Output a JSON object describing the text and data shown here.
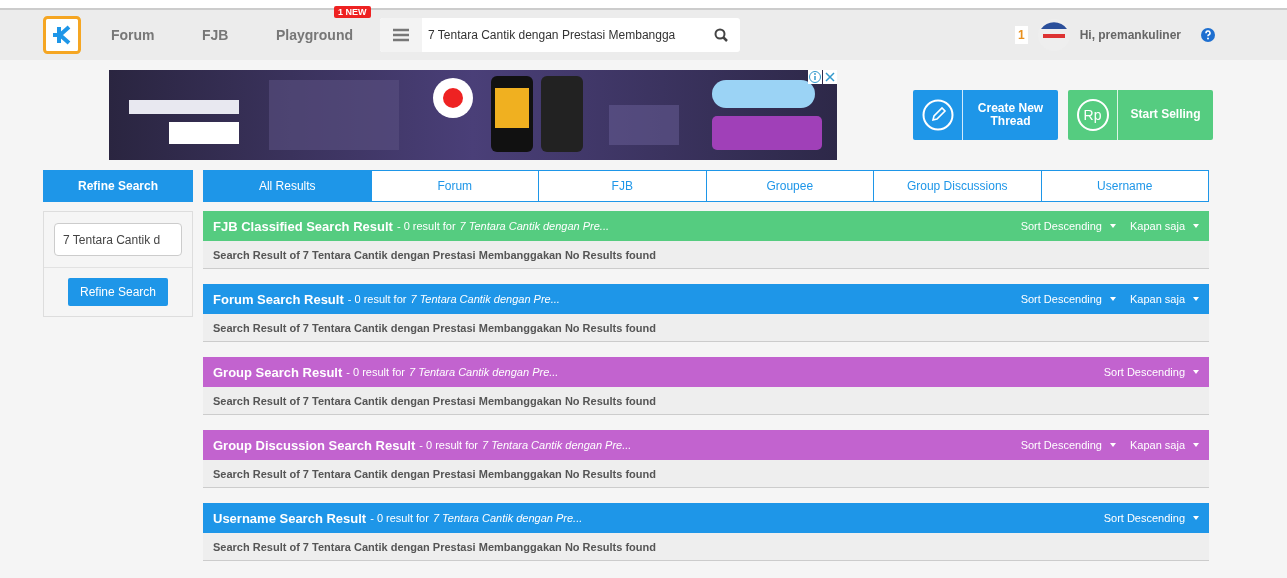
{
  "header": {
    "nav": [
      {
        "label": "Forum"
      },
      {
        "label": "FJB"
      },
      {
        "label": "Playground",
        "badge": "1 NEW"
      }
    ],
    "search": {
      "value": "7 Tentara Cantik dengan Prestasi Membangga"
    },
    "notification_count": "1",
    "greeting": "Hi, premankuliner"
  },
  "actions": [
    {
      "label": "Create New Thread",
      "kind": "thread"
    },
    {
      "label": "Start Selling",
      "kind": "sell",
      "icon_text": "Rp"
    }
  ],
  "sidebar": {
    "title": "Refine Search",
    "field": {
      "value": "7 Tentara Cantik d"
    },
    "button": "Refine Search"
  },
  "tabs": [
    {
      "label": "All Results",
      "selected": true
    },
    {
      "label": "Forum",
      "selected": false
    },
    {
      "label": "FJB",
      "selected": false
    },
    {
      "label": "Groupee",
      "selected": false
    },
    {
      "label": "Group Discussions",
      "selected": false
    },
    {
      "label": "Username",
      "selected": false
    }
  ],
  "sections": [
    {
      "title": "FJB Classified Search Result",
      "summary": "- 0 result for",
      "query": "7 Tentara Cantik dengan Pre...",
      "color": "#55cc80",
      "sort": "Sort Descending",
      "filter": "Kapan saja",
      "body": "Search Result of 7 Tentara Cantik dengan Prestasi Membanggakan No Results found"
    },
    {
      "title": "Forum Search Result",
      "summary": "- 0 result for",
      "query": "7 Tentara Cantik dengan Pre...",
      "color": "#1e96e8",
      "sort": "Sort Descending",
      "filter": "Kapan saja",
      "body": "Search Result of 7 Tentara Cantik dengan Prestasi Membanggakan No Results found"
    },
    {
      "title": "Group Search Result",
      "summary": "- 0 result for",
      "query": "7 Tentara Cantik dengan Pre...",
      "color": "#c263cf",
      "sort": "Sort Descending",
      "body": "Search Result of 7 Tentara Cantik dengan Prestasi Membanggakan No Results found"
    },
    {
      "title": "Group Discussion Search Result",
      "summary": "- 0 result for",
      "query": "7 Tentara Cantik dengan Pre...",
      "color": "#c263cf",
      "sort": "Sort Descending",
      "filter": "Kapan saja",
      "body": "Search Result of 7 Tentara Cantik dengan Prestasi Membanggakan No Results found"
    },
    {
      "title": "Username Search Result",
      "summary": "- 0 result for",
      "query": "7 Tentara Cantik dengan Pre...",
      "color": "#1e96e8",
      "sort": "Sort Descending",
      "body": "Search Result of 7 Tentara Cantik dengan Prestasi Membanggakan No Results found"
    }
  ]
}
